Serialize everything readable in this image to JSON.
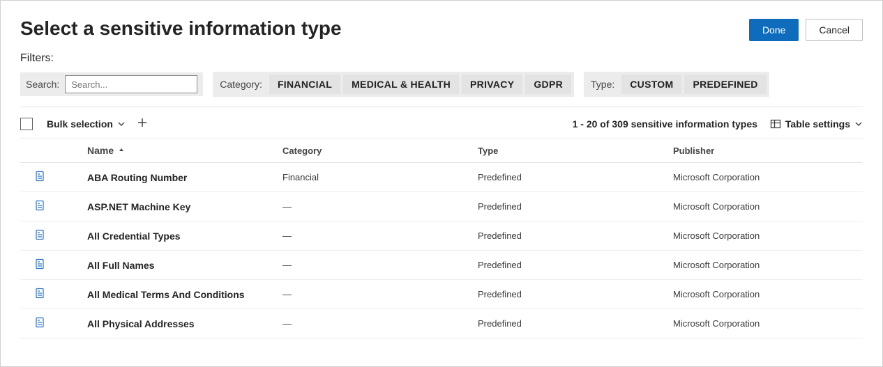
{
  "header": {
    "title": "Select a sensitive information type",
    "done": "Done",
    "cancel": "Cancel"
  },
  "filters": {
    "label": "Filters:",
    "search_label": "Search:",
    "search_placeholder": "Search...",
    "category_label": "Category:",
    "category_chips": [
      "FINANCIAL",
      "MEDICAL & HEALTH",
      "PRIVACY",
      "GDPR"
    ],
    "type_label": "Type:",
    "type_chips": [
      "CUSTOM",
      "PREDEFINED"
    ]
  },
  "toolbar": {
    "bulk_label": "Bulk selection",
    "count_text": "1 - 20 of 309 sensitive information types",
    "table_settings": "Table settings"
  },
  "columns": {
    "name": "Name",
    "category": "Category",
    "type": "Type",
    "publisher": "Publisher"
  },
  "rows": [
    {
      "name": "ABA Routing Number",
      "category": "Financial",
      "type": "Predefined",
      "publisher": "Microsoft Corporation"
    },
    {
      "name": "ASP.NET Machine Key",
      "category": "—",
      "type": "Predefined",
      "publisher": "Microsoft Corporation"
    },
    {
      "name": "All Credential Types",
      "category": "—",
      "type": "Predefined",
      "publisher": "Microsoft Corporation"
    },
    {
      "name": "All Full Names",
      "category": "—",
      "type": "Predefined",
      "publisher": "Microsoft Corporation"
    },
    {
      "name": "All Medical Terms And Conditions",
      "category": "—",
      "type": "Predefined",
      "publisher": "Microsoft Corporation"
    },
    {
      "name": "All Physical Addresses",
      "category": "—",
      "type": "Predefined",
      "publisher": "Microsoft Corporation"
    }
  ]
}
